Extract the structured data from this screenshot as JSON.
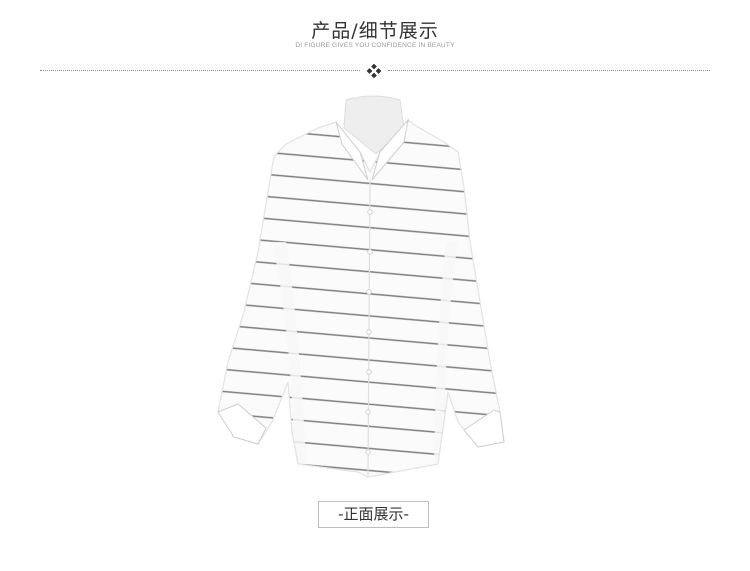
{
  "header": {
    "title": "产品/细节展示",
    "subtitle": "DI FIGURE GIVES YOU CONFIDENCE IN BEAUTY"
  },
  "product": {
    "image_subject": "white horizontal-striped stand-collar button-front shirt on mannequin",
    "caption": "-正面展示-"
  },
  "colors": {
    "text": "#333333",
    "subtext": "#9a9a9a",
    "divider": "#8a8a8a",
    "stripe": "#7d7d7d",
    "shirt": "#fbfbfb"
  },
  "icons": {
    "divider_ornament": "diamond-dots-ornament-icon"
  }
}
